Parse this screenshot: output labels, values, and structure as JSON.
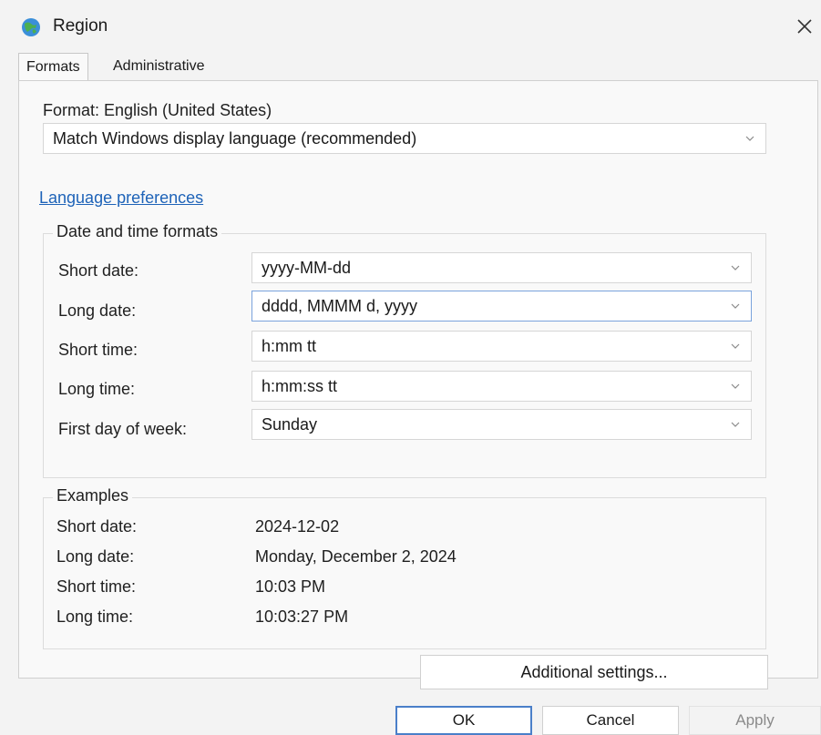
{
  "window": {
    "title": "Region",
    "icon": "globe-icon",
    "close": "close-icon"
  },
  "tabs": [
    {
      "label": "Formats"
    },
    {
      "label": "Administrative"
    }
  ],
  "format": {
    "label": "Format: English (United States)",
    "selected": "Match Windows display language (recommended)"
  },
  "language_link": "Language preferences",
  "date_time_formats": {
    "title": "Date and time formats",
    "rows": [
      {
        "label": "Short date:",
        "value": "yyyy-MM-dd"
      },
      {
        "label": "Long date:",
        "value": "dddd, MMMM d, yyyy"
      },
      {
        "label": "Short time:",
        "value": "h:mm tt"
      },
      {
        "label": "Long time:",
        "value": "h:mm:ss tt"
      },
      {
        "label": "First day of week:",
        "value": "Sunday"
      }
    ]
  },
  "examples": {
    "title": "Examples",
    "rows": [
      {
        "label": "Short date:",
        "value": "2024-12-02"
      },
      {
        "label": "Long date:",
        "value": "Monday, December 2, 2024"
      },
      {
        "label": "Short time:",
        "value": "10:03 PM"
      },
      {
        "label": "Long time:",
        "value": "10:03:27 PM"
      }
    ]
  },
  "buttons": {
    "additional_settings": "Additional settings...",
    "ok": "OK",
    "cancel": "Cancel",
    "apply": "Apply"
  },
  "colors": {
    "accent": "#1e63b8",
    "focus_border": "#7aa3dc",
    "default_button_border": "#4a7fc9"
  }
}
